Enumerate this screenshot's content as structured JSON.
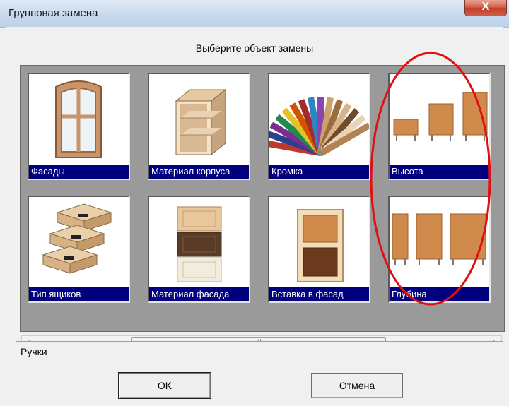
{
  "window": {
    "title": "Групповая замена",
    "close_symbol": "X"
  },
  "header": {
    "label": "Выберите объект замены"
  },
  "tiles": [
    {
      "label": "Фасады",
      "icon": "facade-door-icon"
    },
    {
      "label": "Материал корпуса",
      "icon": "cabinet-body-icon"
    },
    {
      "label": "Кромка",
      "icon": "edge-color-fan-icon"
    },
    {
      "label": "Высота",
      "icon": "height-cabinets-icon"
    },
    {
      "label": "Тип ящиков",
      "icon": "drawers-icon"
    },
    {
      "label": "Материал фасада",
      "icon": "facade-material-icon"
    },
    {
      "label": "Вставка в фасад",
      "icon": "facade-insert-icon"
    },
    {
      "label": "Глубина",
      "icon": "depth-cabinets-icon"
    }
  ],
  "scrollbar": {
    "left_arrow": "◂",
    "right_arrow": "▸",
    "thumb_grip": "III"
  },
  "status": {
    "text": "Ручки"
  },
  "buttons": {
    "ok_label": "OK",
    "cancel_label": "Отмена"
  },
  "colors": {
    "caption_bg": "#00007f",
    "annotation": "#e01010"
  }
}
